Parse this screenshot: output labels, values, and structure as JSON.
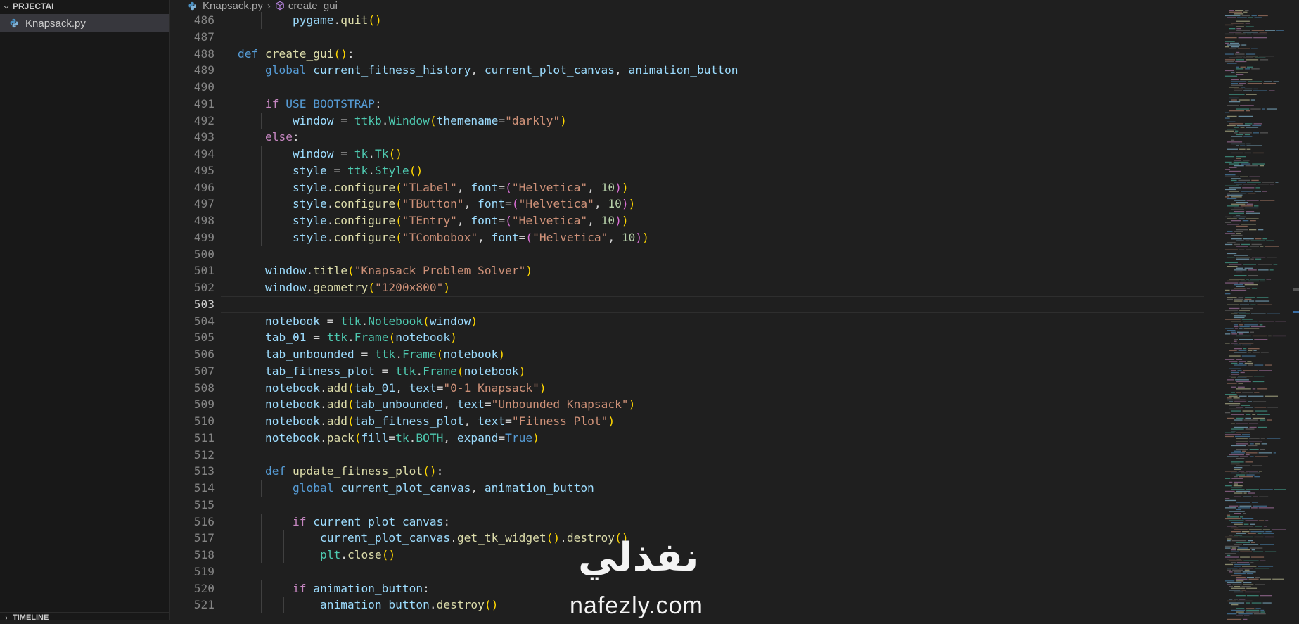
{
  "explorer": {
    "project_name": "PRJECTAI",
    "files": [
      {
        "name": "Knapsack.py",
        "icon": "python-file-icon"
      }
    ],
    "timeline_label": "TIMELINE"
  },
  "breadcrumb": {
    "file": "Knapsack.py",
    "symbol": "create_gui"
  },
  "editor": {
    "active_line": "503",
    "lines": [
      {
        "num": "486",
        "code": "        pygame.quit()"
      },
      {
        "num": "487",
        "code": ""
      },
      {
        "num": "488",
        "code": "def create_gui():"
      },
      {
        "num": "489",
        "code": "    global current_fitness_history, current_plot_canvas, animation_button"
      },
      {
        "num": "490",
        "code": ""
      },
      {
        "num": "491",
        "code": "    if USE_BOOTSTRAP:"
      },
      {
        "num": "492",
        "code": "        window = ttkb.Window(themename=\"darkly\")"
      },
      {
        "num": "493",
        "code": "    else:"
      },
      {
        "num": "494",
        "code": "        window = tk.Tk()"
      },
      {
        "num": "495",
        "code": "        style = ttk.Style()"
      },
      {
        "num": "496",
        "code": "        style.configure(\"TLabel\", font=(\"Helvetica\", 10))"
      },
      {
        "num": "497",
        "code": "        style.configure(\"TButton\", font=(\"Helvetica\", 10))"
      },
      {
        "num": "498",
        "code": "        style.configure(\"TEntry\", font=(\"Helvetica\", 10))"
      },
      {
        "num": "499",
        "code": "        style.configure(\"TCombobox\", font=(\"Helvetica\", 10))"
      },
      {
        "num": "500",
        "code": ""
      },
      {
        "num": "501",
        "code": "    window.title(\"Knapsack Problem Solver\")"
      },
      {
        "num": "502",
        "code": "    window.geometry(\"1200x800\")"
      },
      {
        "num": "503",
        "code": ""
      },
      {
        "num": "504",
        "code": "    notebook = ttk.Notebook(window)"
      },
      {
        "num": "505",
        "code": "    tab_01 = ttk.Frame(notebook)"
      },
      {
        "num": "506",
        "code": "    tab_unbounded = ttk.Frame(notebook)"
      },
      {
        "num": "507",
        "code": "    tab_fitness_plot = ttk.Frame(notebook)"
      },
      {
        "num": "508",
        "code": "    notebook.add(tab_01, text=\"0-1 Knapsack\")"
      },
      {
        "num": "509",
        "code": "    notebook.add(tab_unbounded, text=\"Unbounded Knapsack\")"
      },
      {
        "num": "510",
        "code": "    notebook.add(tab_fitness_plot, text=\"Fitness Plot\")"
      },
      {
        "num": "511",
        "code": "    notebook.pack(fill=tk.BOTH, expand=True)"
      },
      {
        "num": "512",
        "code": ""
      },
      {
        "num": "513",
        "code": "    def update_fitness_plot():"
      },
      {
        "num": "514",
        "code": "        global current_plot_canvas, animation_button"
      },
      {
        "num": "515",
        "code": ""
      },
      {
        "num": "516",
        "code": "        if current_plot_canvas:"
      },
      {
        "num": "517",
        "code": "            current_plot_canvas.get_tk_widget().destroy()"
      },
      {
        "num": "518",
        "code": "            plt.close()"
      },
      {
        "num": "519",
        "code": ""
      },
      {
        "num": "520",
        "code": "        if animation_button:"
      },
      {
        "num": "521",
        "code": "            animation_button.destroy()"
      }
    ]
  },
  "watermark": {
    "arabic": "نفذلي",
    "latin": "nafezly.com"
  },
  "colors": {
    "editor_bg": "#1f1f1f",
    "sidebar_bg": "#181818",
    "selected_file_bg": "#37373d",
    "keyword_blue": "#569cd6",
    "keyword_purple": "#c586c0",
    "function": "#dcdcaa",
    "variable": "#9cdcfe",
    "class": "#4ec9b0",
    "string": "#ce9178",
    "number": "#b5cea8"
  }
}
